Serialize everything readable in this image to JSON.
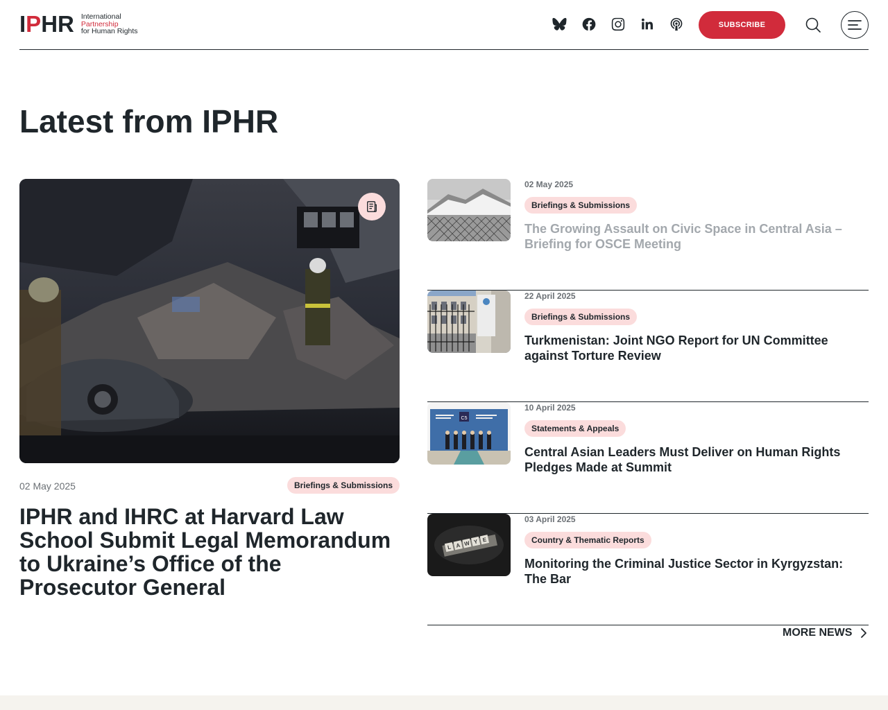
{
  "header": {
    "logo_mark_1": "I",
    "logo_mark_2": "P",
    "logo_mark_3": "HR",
    "logo_line_1": "International",
    "logo_line_2": "Partnership",
    "logo_line_3": "for Human Rights",
    "subscribe_label": "SUBSCRIBE",
    "socials": [
      "bluesky-icon",
      "facebook-icon",
      "instagram-icon",
      "linkedin-icon",
      "podcast-icon"
    ]
  },
  "section": {
    "title": "Latest from IPHR"
  },
  "featured": {
    "date": "02 May 2025",
    "tag": "Briefings & Submissions",
    "title": "IPHR and IHRC at Harvard Law School Submit Legal Memorandum to Ukraine’s Office of the Prosecutor General"
  },
  "news": [
    {
      "date": "02 May 2025",
      "tag": "Briefings & Submissions",
      "title": "The Growing Assault on Civic Space in Central Asia – Briefing for OSCE Meeting"
    },
    {
      "date": "22 April 2025",
      "tag": "Briefings & Submissions",
      "title": "Turkmenistan: Joint NGO Report for UN Committee against Torture Review"
    },
    {
      "date": "10 April 2025",
      "tag": "Statements & Appeals",
      "title": "Central Asian Leaders Must Deliver on Human Rights Pledges Made at Summit"
    },
    {
      "date": "03 April 2025",
      "tag": "Country & Thematic Reports",
      "title": "Monitoring the Criminal Justice Sector in Kyrgyzstan: The Bar"
    }
  ],
  "more_news_label": "MORE NEWS",
  "colors": {
    "accent": "#d12b3b",
    "tag_bg": "#fbdcdc",
    "text": "#1f262b",
    "muted": "#6b7075"
  }
}
